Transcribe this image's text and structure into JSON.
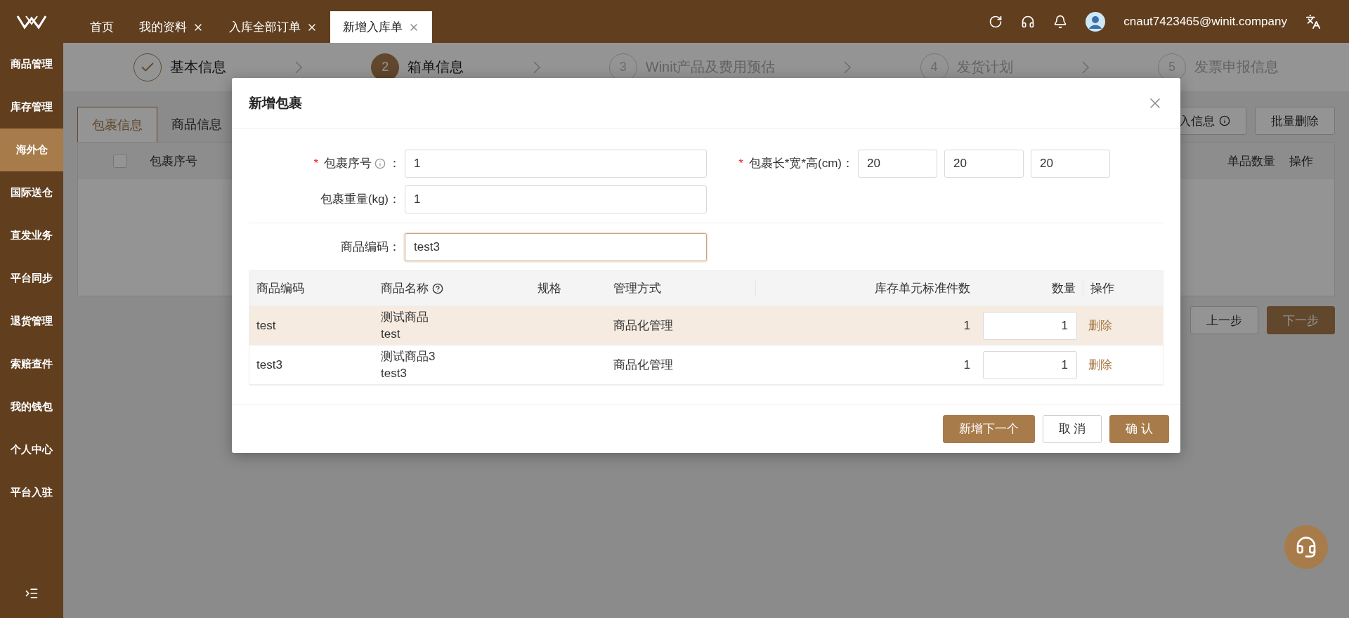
{
  "header": {
    "tabs": [
      {
        "label": "首页",
        "closable": false,
        "selected": false
      },
      {
        "label": "我的资料",
        "closable": true,
        "selected": false
      },
      {
        "label": "入库全部订单",
        "closable": true,
        "selected": false
      },
      {
        "label": "新增入库单",
        "closable": true,
        "selected": true
      }
    ],
    "user": "cnaut7423465@winit.company"
  },
  "sidebar": {
    "items": [
      {
        "label": "商品管理",
        "selected": false
      },
      {
        "label": "库存管理",
        "selected": false
      },
      {
        "label": "海外仓",
        "selected": true
      },
      {
        "label": "国际送仓",
        "selected": false
      },
      {
        "label": "直发业务",
        "selected": false
      },
      {
        "label": "平台同步",
        "selected": false
      },
      {
        "label": "退货管理",
        "selected": false
      },
      {
        "label": "索赔查件",
        "selected": false
      },
      {
        "label": "我的钱包",
        "selected": false
      },
      {
        "label": "个人中心",
        "selected": false
      },
      {
        "label": "平台入驻",
        "selected": false
      }
    ]
  },
  "steps": [
    {
      "label": "基本信息",
      "done": true,
      "active": false
    },
    {
      "number": "2",
      "label": "箱单信息",
      "done": false,
      "active": true
    },
    {
      "number": "3",
      "label": "Winit产品及费用预估",
      "done": false,
      "active": false
    },
    {
      "number": "4",
      "label": "发货计划",
      "done": false,
      "active": false
    },
    {
      "number": "5",
      "label": "发票申报信息",
      "done": false,
      "active": false
    }
  ],
  "page": {
    "tabs": [
      {
        "label": "包裹信息",
        "selected": true
      },
      {
        "label": "商品信息",
        "selected": false
      }
    ],
    "select_all_checked": false,
    "import_button": "入信息",
    "delete_button": "批量删除",
    "columns": [
      "包裹序号",
      "单品数量",
      "操作"
    ],
    "prev_button": "上一步",
    "next_button": "下一步"
  },
  "modal": {
    "title": "新增包裹",
    "package_no": {
      "required_mark": "*",
      "label": "包裹序号",
      "colon": "：",
      "value": "1"
    },
    "dimensions": {
      "required_mark": "*",
      "label": "包裹长*宽*高(cm)：",
      "values": [
        "20",
        "20",
        "20"
      ]
    },
    "weight": {
      "label": "包裹重量(kg)：",
      "value": "1"
    },
    "sku": {
      "label": "商品编码：",
      "value": "test3"
    },
    "columns": [
      "商品编码",
      "商品名称",
      "规格",
      "管理方式",
      "库存单元标准件数",
      "数量",
      "操作"
    ],
    "rows": [
      {
        "code": "test",
        "name": "测试商品",
        "sub_name": "test",
        "mode": "商品化管理",
        "units": "1",
        "quantity": "1",
        "action": "删除",
        "highlighted": true
      },
      {
        "code": "test3",
        "name": "测试商品3",
        "sub_name": "test3",
        "mode": "商品化管理",
        "units": "1",
        "quantity": "1",
        "action": "删除",
        "highlighted": false
      }
    ],
    "buttons": {
      "add_next": "新增下一个",
      "cancel": "取 消",
      "confirm": "确 认"
    }
  }
}
